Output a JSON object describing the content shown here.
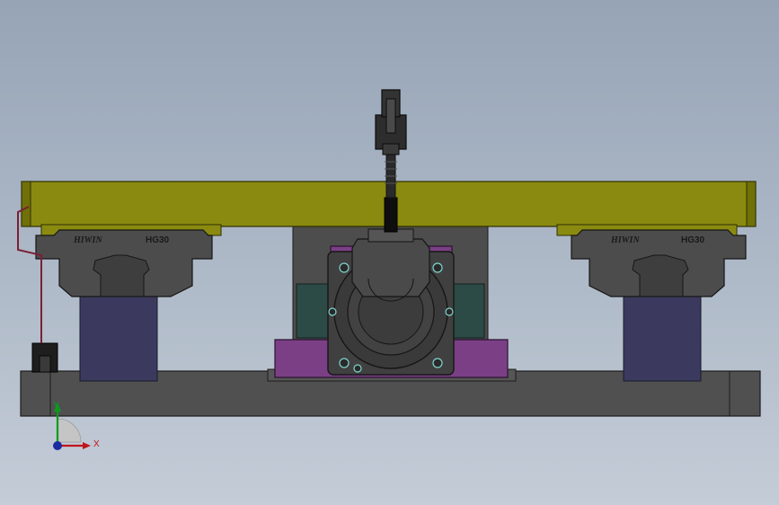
{
  "scene": {
    "view": "front",
    "parts": [
      "base-plate",
      "top-table",
      "linear-guide-blocks",
      "rails",
      "servo-motor",
      "motor-mount",
      "coupling",
      "connector",
      "sensor-bracket",
      "cable"
    ]
  },
  "guide_left": {
    "brand": "HIWIN",
    "model": "HG30"
  },
  "guide_right": {
    "brand": "HIWIN",
    "model": "HG30"
  },
  "triad": {
    "x_label": "X",
    "y_label": "Y"
  },
  "colors": {
    "background": "#a5b2c2",
    "table": "#8a8a10",
    "base": "#505050",
    "rail": "#3b3a5e",
    "block": "#4c4c4c",
    "motor_frame": "#7b3f86",
    "motor_body": "#3e3e3e",
    "motor_side": "#2c4b46",
    "x_axis": "#c0141c",
    "y_axis": "#0a9b1e",
    "z_axis": "#1c2ba0"
  }
}
